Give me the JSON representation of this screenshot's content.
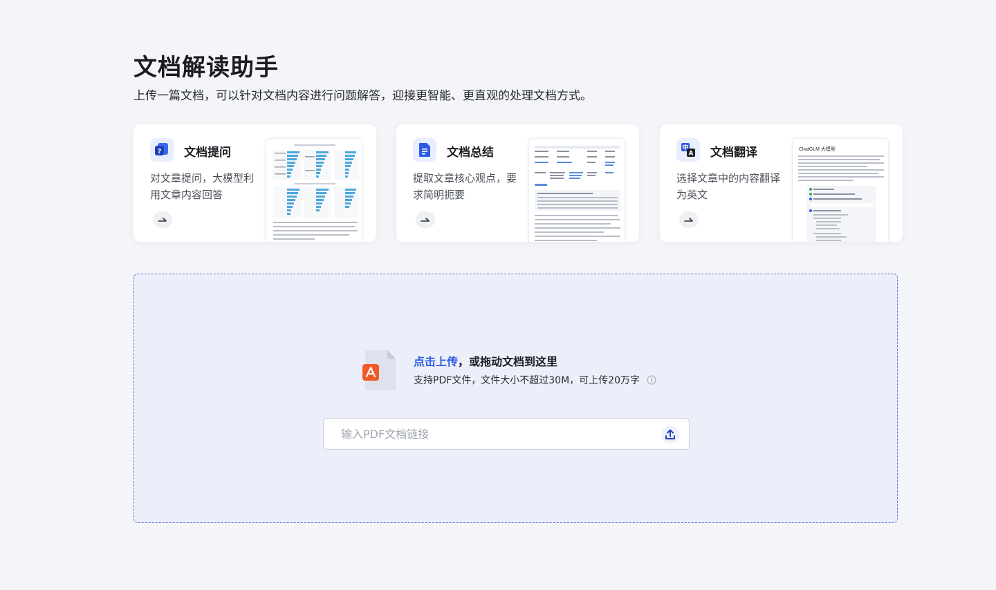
{
  "header": {
    "title": "文档解读助手",
    "subtitle": "上传一篇文档，可以针对文档内容进行问题解答，迎接更智能、更直观的处理文档方式。"
  },
  "cards": [
    {
      "title": "文档提问",
      "desc": "对文章提问，大模型利用文章内容回答",
      "icon": "doc-question-icon"
    },
    {
      "title": "文档总结",
      "desc": "提取文章核心观点，要求简明扼要",
      "icon": "doc-summary-icon"
    },
    {
      "title": "文档翻译",
      "desc": "选择文章中的内容翻译为英文",
      "icon": "translate-icon"
    }
  ],
  "previews": {
    "translate_heading": "ChatGLM 大模型"
  },
  "upload": {
    "link_text": "点击上传",
    "title_rest": "，或拖动文档到这里",
    "hint": "支持PDF文件，文件大小不超过30M，可上传20万字",
    "url_placeholder": "输入PDF文档链接"
  },
  "colors": {
    "accent": "#2d5be3",
    "pdf_red": "#f05a28",
    "page_bg": "#f4f5f8",
    "upload_bg": "#eceff9"
  }
}
